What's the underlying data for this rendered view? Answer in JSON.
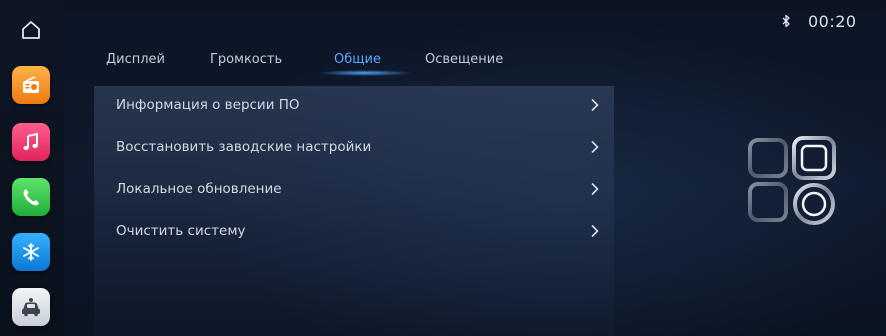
{
  "status": {
    "time": "00:20"
  },
  "dock": {
    "apps": [
      "radio-icon",
      "music-icon",
      "phone-icon",
      "climate-icon",
      "car-icon"
    ],
    "colors": {
      "radio": "#f59a2a",
      "music": "#ee3f73",
      "phone": "#34c84c",
      "climate": "#1f95ee",
      "car": "#dfe3e9"
    }
  },
  "tabs": [
    {
      "label": "Дисплей"
    },
    {
      "label": "Громкость"
    },
    {
      "label": "Общие"
    },
    {
      "label": "Освещение"
    }
  ],
  "active_tab": "Общие",
  "settings": [
    {
      "label": "Информация о версии ПО"
    },
    {
      "label": "Восстановить заводские настройки"
    },
    {
      "label": "Локальное обновление"
    },
    {
      "label": "Очистить систему"
    }
  ],
  "accent_color": "#5aa8ff"
}
